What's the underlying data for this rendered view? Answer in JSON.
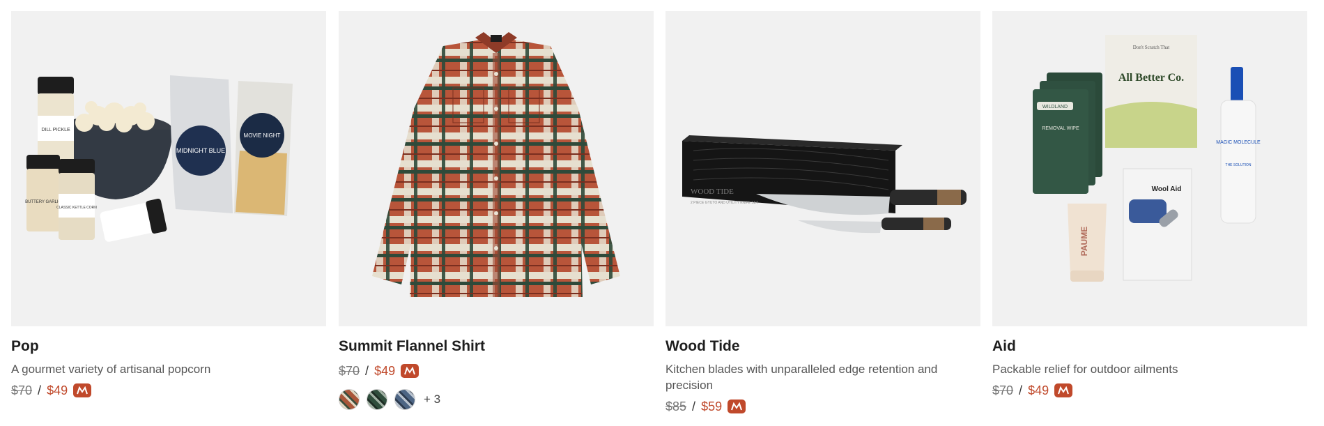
{
  "products": [
    {
      "title": "Pop",
      "description": "A gourmet variety of artisanal popcorn",
      "price_was": "$70",
      "price_sep": "/",
      "price_now": "$49",
      "labels": {
        "jar1": "DILL PICKLE",
        "jar2": "BUTTERY GARLIC",
        "jar3": "CLASSIC KETTLE CORN",
        "bag1": "MIDNIGHT BLUE",
        "bag2": "MOVIE NIGHT"
      }
    },
    {
      "title": "Summit Flannel Shirt",
      "price_was": "$70",
      "price_sep": "/",
      "price_now": "$49",
      "swatch_more": "+ 3",
      "swatch_colors": [
        "#a9563a",
        "#2f4d3c",
        "#4d6584"
      ]
    },
    {
      "title": "Wood Tide",
      "description": "Kitchen blades with unparalleled edge retention and precision",
      "price_was": "$85",
      "price_sep": "/",
      "price_now": "$59",
      "labels": {
        "box": "WOOD TIDE",
        "box_sub": "2 PIECE GYUTO AND UTILITY KNIFE SET"
      }
    },
    {
      "title": "Aid",
      "description": "Packable relief for outdoor ailments",
      "price_was": "$70",
      "price_sep": "/",
      "price_now": "$49",
      "labels": {
        "pack_top": "Don't Scratch That",
        "pack_brand": "All Better Co.",
        "wipes_brand": "WILDLAND",
        "wipes_text": "REMOVAL WIPE",
        "bottle": "MAGIC MOLECULE",
        "bottle_sub": "THE SOLUTION",
        "wool": "Wool Aid",
        "tube": "PAUME"
      }
    }
  ],
  "colors": {
    "accent": "#c0492b",
    "card_bg": "#f1f1f1"
  }
}
